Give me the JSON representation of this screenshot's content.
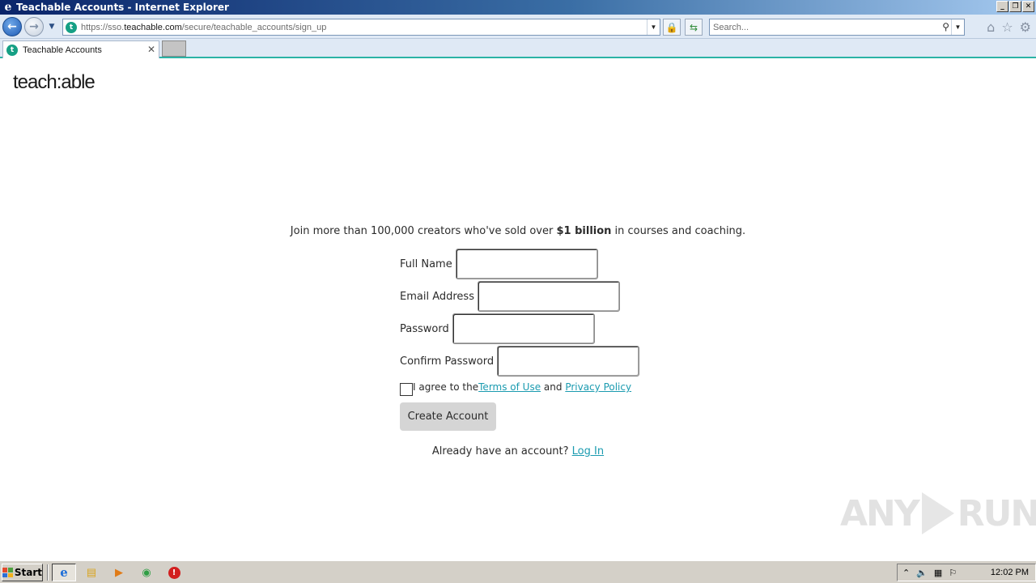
{
  "window": {
    "title": "Teachable Accounts - Internet Explorer",
    "ie_icon": "e",
    "minimize": "_",
    "maximize": "❐",
    "close": "✕"
  },
  "nav": {
    "back": "←",
    "forward": "→",
    "history": "▼",
    "url_domain_prefix": "https://sso.",
    "url_domain": "teachable.com",
    "url_path": "/secure/teachable_accounts/sign_up",
    "dropdown": "▼",
    "lock": "🔒",
    "compat": "⇆",
    "search_placeholder": "Search...",
    "search_icon": "⚲",
    "search_dropdown": "▼",
    "home": "⌂",
    "favorites": "☆",
    "tools": "⚙"
  },
  "tabs": [
    {
      "icon": "t",
      "label": "Teachable Accounts",
      "close": "✕"
    }
  ],
  "page": {
    "logo": "teach:able",
    "tagline_pre": "Join more than 100,000 creators who've sold over ",
    "tagline_bold": "$1 billion",
    "tagline_post": " in courses and coaching.",
    "fields": {
      "full_name": {
        "label": "Full Name",
        "value": ""
      },
      "email": {
        "label": "Email Address",
        "value": ""
      },
      "password": {
        "label": "Password",
        "value": ""
      },
      "confirm_password": {
        "label": "Confirm Password",
        "value": ""
      }
    },
    "agree_pre": "I agree to the ",
    "terms_link": "Terms of Use",
    "agree_mid": " and ",
    "privacy_link": "Privacy Policy",
    "create_button": "Create Account",
    "already_text": "Already have an account? ",
    "login_link": "Log In"
  },
  "watermark": {
    "left": "ANY",
    "right": "RUN"
  },
  "taskbar": {
    "start": "Start",
    "apps": [
      {
        "name": "internet-explorer",
        "glyph": "e",
        "color": "#1e6fd8"
      },
      {
        "name": "file-explorer",
        "glyph": "▤",
        "color": "#d9a521"
      },
      {
        "name": "media-player",
        "glyph": "▶",
        "color": "#e07b17"
      },
      {
        "name": "chrome",
        "glyph": "◉",
        "color": "#2f9e44"
      },
      {
        "name": "stop-app",
        "glyph": "!",
        "color": "#d21f1f"
      }
    ],
    "tray": {
      "expand": "⌃",
      "volume": "🔈",
      "network": "▦",
      "flag": "⚐",
      "clock": "12:02 PM"
    }
  }
}
